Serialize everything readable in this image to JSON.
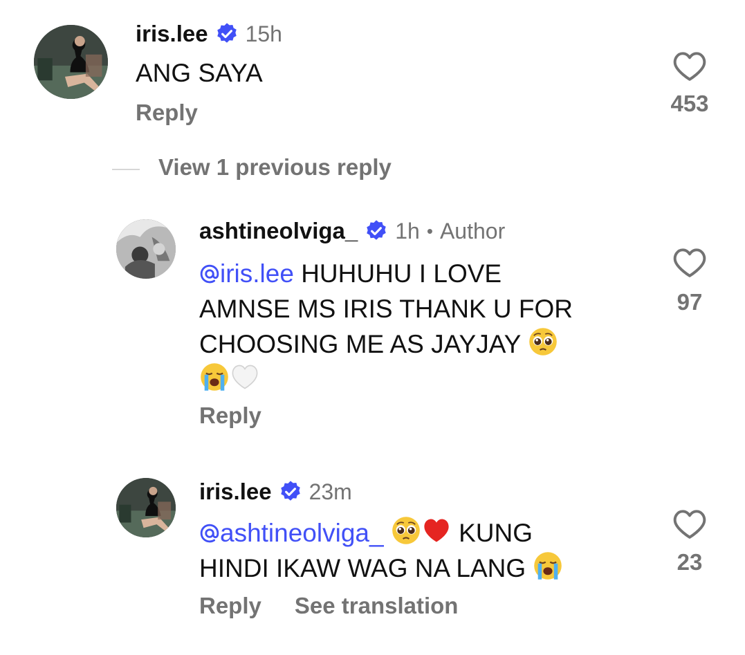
{
  "comments": [
    {
      "username": "iris.lee",
      "verified": true,
      "timestamp": "15h",
      "text": "ANG SAYA",
      "reply_label": "Reply",
      "likes": "453",
      "avatar_icon": "user-avatar-photo"
    }
  ],
  "view_replies": {
    "label": "View 1 previous reply"
  },
  "replies": [
    {
      "username": "ashtineolviga_",
      "verified": true,
      "timestamp": "1h",
      "author_label": "Author",
      "mention": "iris.lee",
      "text_line1": "HUHUHU I LOVE",
      "text_line2": "AMNSE MS IRIS THANK U FOR",
      "text_line3": "CHOOSING ME AS JAYJAY",
      "emojis": [
        "pleading-face-emoji",
        "crying-face-emoji",
        "white-heart-emoji"
      ],
      "reply_label": "Reply",
      "likes": "97",
      "avatar_icon": "user-avatar-photo"
    },
    {
      "username": "iris.lee",
      "verified": true,
      "timestamp": "23m",
      "mention": "ashtineolviga_",
      "text_line1": "KUNG",
      "text_line2": "HINDI IKAW WAG NA LANG",
      "emojis": [
        "pleading-face-emoji",
        "red-heart-emoji",
        "crying-face-emoji"
      ],
      "reply_label": "Reply",
      "see_translation_label": "See translation",
      "likes": "23",
      "avatar_icon": "user-avatar-photo"
    }
  ],
  "colors": {
    "text": "#111111",
    "secondary": "#737373",
    "mention": "#4150f7",
    "verified": "#4150f7"
  }
}
